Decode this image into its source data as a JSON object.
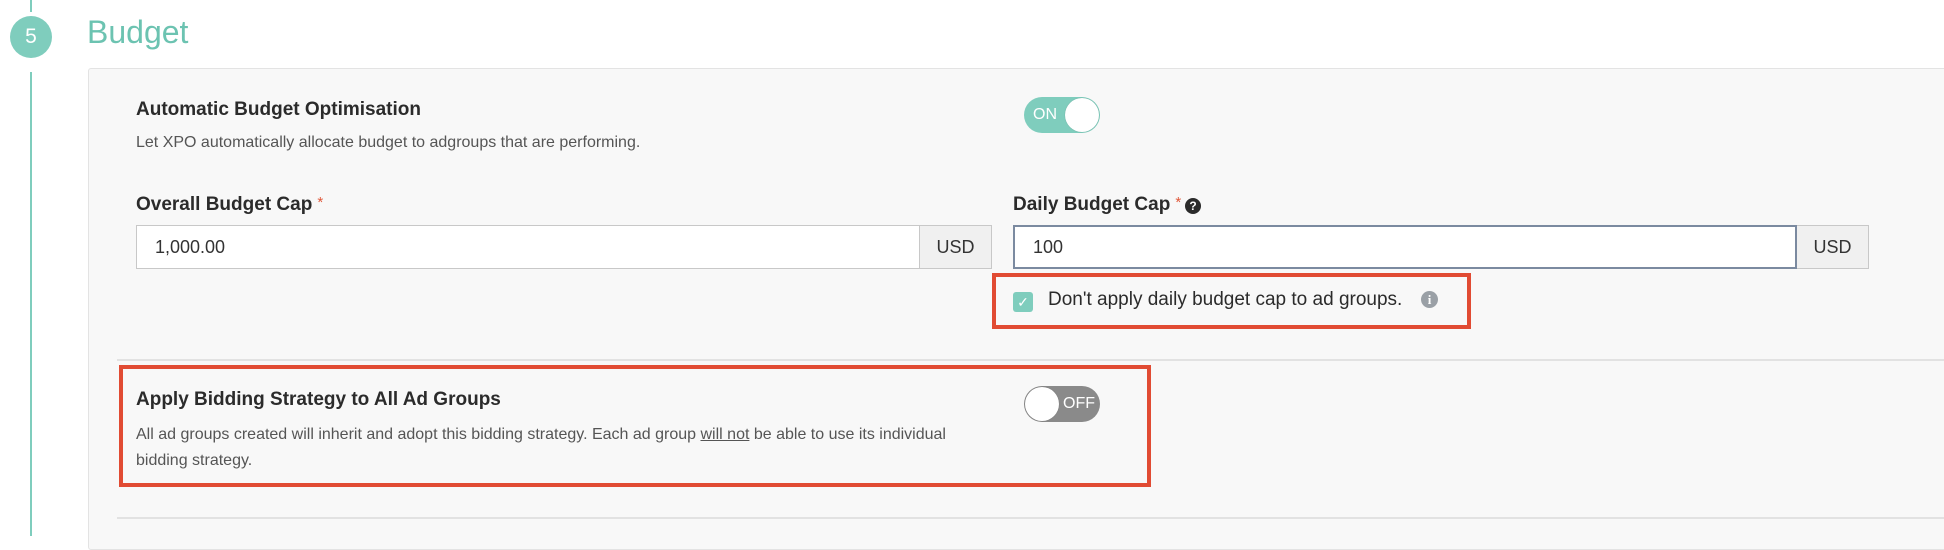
{
  "section": {
    "step_number": "5",
    "title": "Budget"
  },
  "auto_budget": {
    "label": "Automatic Budget Optimisation",
    "description": "Let XPO automatically allocate budget to adgroups that are performing.",
    "toggle_state": "ON"
  },
  "overall_cap": {
    "label": "Overall Budget Cap",
    "required_mark": "*",
    "value": "1,000.00",
    "currency": "USD"
  },
  "daily_cap": {
    "label": "Daily Budget Cap",
    "required_mark": "*",
    "help_icon": "?",
    "value": "100",
    "currency": "USD",
    "checkbox_label": "Don't apply daily budget cap to ad groups.",
    "checkbox_checked": true,
    "info_icon": "i"
  },
  "bidding": {
    "label": "Apply Bidding Strategy to All Ad Groups",
    "description_before": "All ad groups created will inherit and adopt this bidding strategy. Each ad group ",
    "description_underlined": "will not",
    "description_after": " be able to use its individual bidding strategy.",
    "toggle_state": "OFF"
  },
  "colors": {
    "accent": "#7fcdbd",
    "highlight": "#e14b33",
    "toggle_off": "#8a8a8a"
  }
}
